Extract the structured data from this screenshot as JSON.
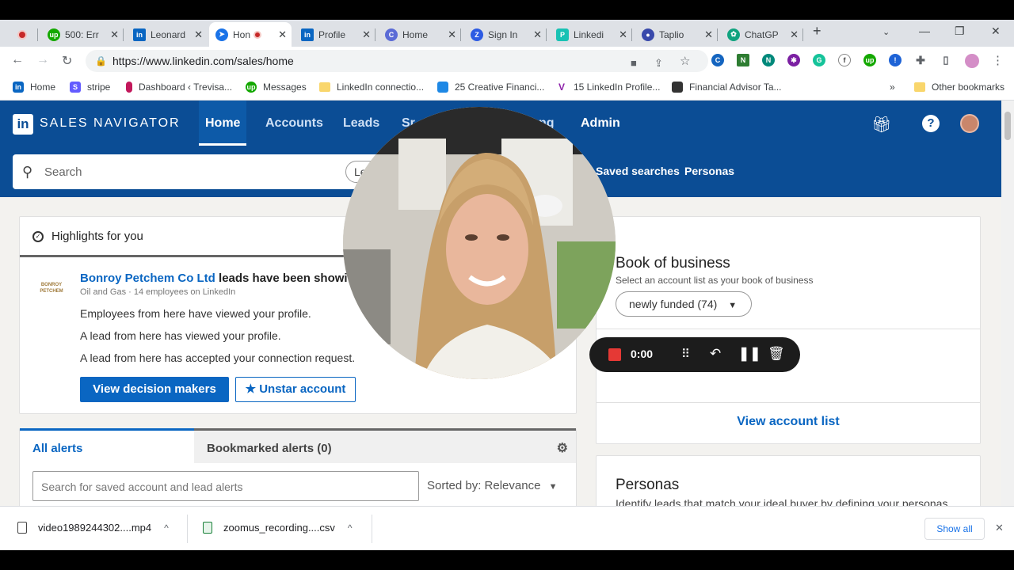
{
  "browser": {
    "tabs": [
      {
        "label": "",
        "icon": "record-dot-icon"
      },
      {
        "label": "500: Err",
        "icon": "upwork-icon",
        "color": "#14a800",
        "glyph": "up"
      },
      {
        "label": "Leonard",
        "icon": "linkedin-icon",
        "color": "#0a66c2",
        "glyph": "in"
      },
      {
        "label": "Hon",
        "icon": "compass-icon",
        "color": "#1a73e8",
        "glyph": "➤"
      },
      {
        "label": "Profile",
        "icon": "linkedin-icon",
        "color": "#0a66c2",
        "glyph": "in"
      },
      {
        "label": "Home",
        "icon": "chrome-app-icon",
        "color": "#5b6bd6",
        "glyph": "C"
      },
      {
        "label": "Sign In",
        "icon": "z-icon",
        "color": "#2d5be3",
        "glyph": "Z"
      },
      {
        "label": "Linkedi",
        "icon": "taplio-icon",
        "color": "#19c2b4",
        "glyph": "P"
      },
      {
        "label": "Taplio",
        "icon": "circle-icon",
        "color": "#3949ab",
        "glyph": "●"
      },
      {
        "label": "ChatGP",
        "icon": "chatgpt-icon",
        "color": "#10a37f",
        "glyph": "✿"
      }
    ],
    "new_tab": "+",
    "url": "https://www.linkedin.com/sales/home",
    "bookmarks": [
      {
        "label": "Home",
        "glyph": "in",
        "color": "#0a66c2"
      },
      {
        "label": "stripe",
        "glyph": "S",
        "color": "#635bff"
      },
      {
        "label": "Dashboard ‹ Trevisa...",
        "glyph": "",
        "color": "#c2185b"
      },
      {
        "label": "Messages",
        "glyph": "up",
        "color": "#14a800"
      },
      {
        "label": "LinkedIn connectio...",
        "glyph": "",
        "color": "folder"
      },
      {
        "label": "25 Creative Financi...",
        "glyph": "",
        "color": "#1e88e5"
      },
      {
        "label": "15 LinkedIn Profile...",
        "glyph": "V",
        "color": "#8e24aa"
      },
      {
        "label": "Financial Advisor Ta...",
        "glyph": "",
        "color": "#333333"
      }
    ],
    "more_bookmarks": "»",
    "other_bookmarks": "Other bookmarks"
  },
  "salesnav": {
    "brand": "SALES NAVIGATOR",
    "nav": [
      "Home",
      "Accounts",
      "Leads",
      "Sr",
      "ng",
      "Admin"
    ],
    "search_placeholder": "Search",
    "search_pill": "Le",
    "header_links": [
      "Saved searches",
      "Personas"
    ],
    "highlights": {
      "title": "Highlights for you",
      "company_logo_text": "BONROY PETCHEM",
      "company": "Bonroy Petchem Co Ltd",
      "headline_rest": "leads have been showi",
      "sub": "Oil and Gas · 14 employees on LinkedIn",
      "lines": [
        "Employees from here have viewed your profile.",
        "A lead from here has viewed your profile.",
        "A lead from here has accepted your connection request."
      ],
      "primary_button": "View decision makers",
      "secondary_button": "Unstar account"
    },
    "alerts": {
      "tab_all": "All alerts",
      "tab_bookmarked": "Bookmarked alerts (0)",
      "search_placeholder": "Search for saved account and lead alerts",
      "sorted": "Sorted by: Relevance"
    },
    "book": {
      "title": "Book of business",
      "subtitle": "Select an account list as your book of business",
      "select": "newly funded (74)",
      "count": "74",
      "link": "View account list"
    },
    "personas": {
      "title": "Personas",
      "subtitle": "Identify leads that match your ideal buyer by defining your personas."
    }
  },
  "recorder": {
    "time": "0:00"
  },
  "downloads": {
    "items": [
      "video1989244302....mp4",
      "zoomus_recording....csv"
    ],
    "show_all": "Show all"
  }
}
